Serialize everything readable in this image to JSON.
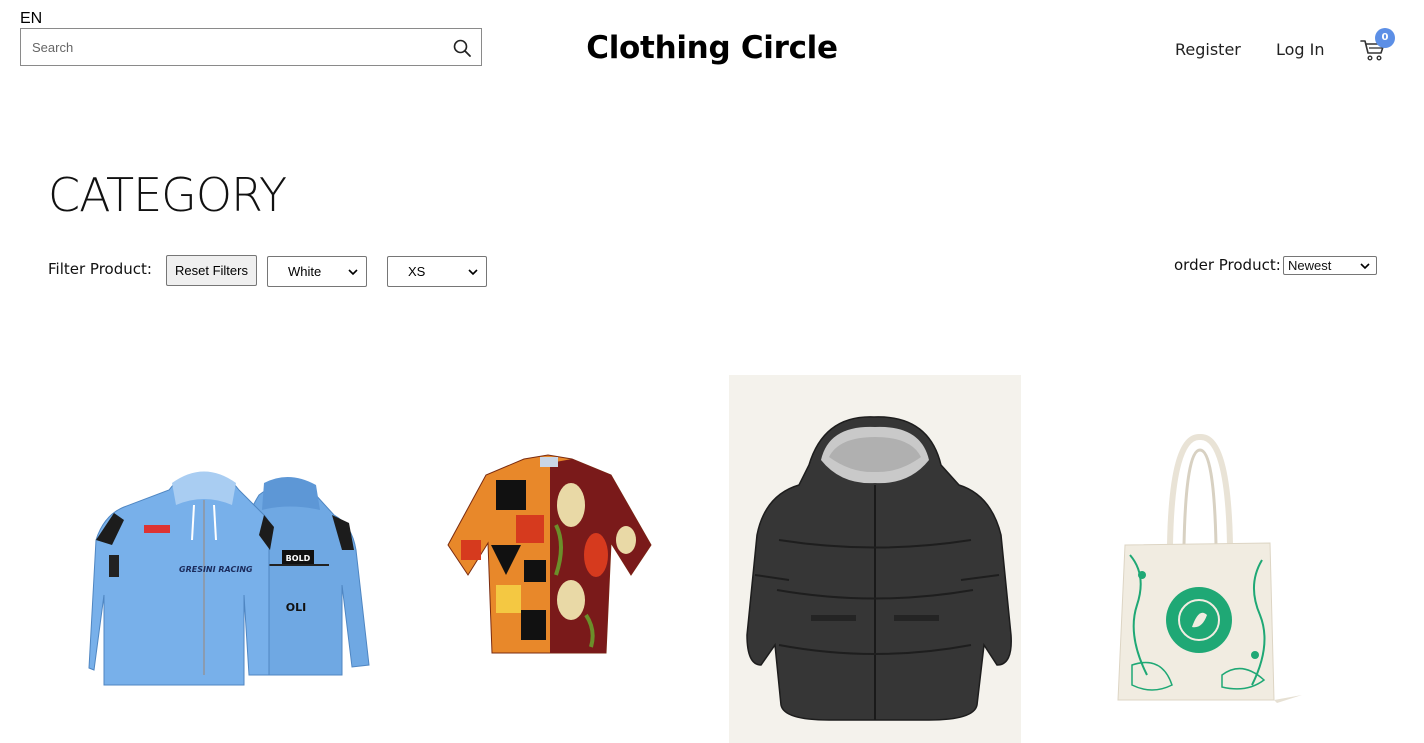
{
  "header": {
    "language": "EN",
    "search_placeholder": "Search",
    "brand": "Clothing Circle",
    "register": "Register",
    "login": "Log In",
    "cart_count": "0"
  },
  "main": {
    "title": "CATEGORY",
    "filter_label": "Filter Product:",
    "reset_label": "Reset Filters",
    "color_selected": "White",
    "size_selected": "XS",
    "order_label": "order Product:",
    "order_selected": "Newest"
  },
  "products": [
    {
      "name": "blue-racing-hoodie"
    },
    {
      "name": "patterned-short-sleeve-shirt"
    },
    {
      "name": "black-puffer-jacket"
    },
    {
      "name": "eco-tote-bag"
    }
  ],
  "colors": {
    "cart_badge": "#5c8fe6",
    "hoodie_blue": "#6fa8e3",
    "jacket": "#333333",
    "tote": "#f1ece1",
    "tote_print": "#1fa875"
  }
}
